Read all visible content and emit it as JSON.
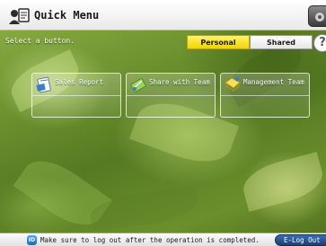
{
  "header": {
    "title": "Quick Menu",
    "icon": "quick-menu-icon"
  },
  "prompt": "Select a button.",
  "tabs": [
    {
      "label": "Personal",
      "selected": true
    },
    {
      "label": "Shared",
      "selected": false
    }
  ],
  "help": {
    "label": "?"
  },
  "buttons": [
    {
      "label": "Sales Report",
      "icon": "document-icon"
    },
    {
      "label": "Share with Team",
      "icon": "send-icon"
    },
    {
      "label": "Management Team",
      "icon": "folder-icon"
    }
  ],
  "footer": {
    "id_badge": "ID",
    "message": "Make sure to log out after the operation is completed.",
    "logout_label": "E-Log Out"
  },
  "colors": {
    "selected_tab": "#f0d400",
    "logout": "#1c3f73",
    "background": "#6f9430"
  }
}
